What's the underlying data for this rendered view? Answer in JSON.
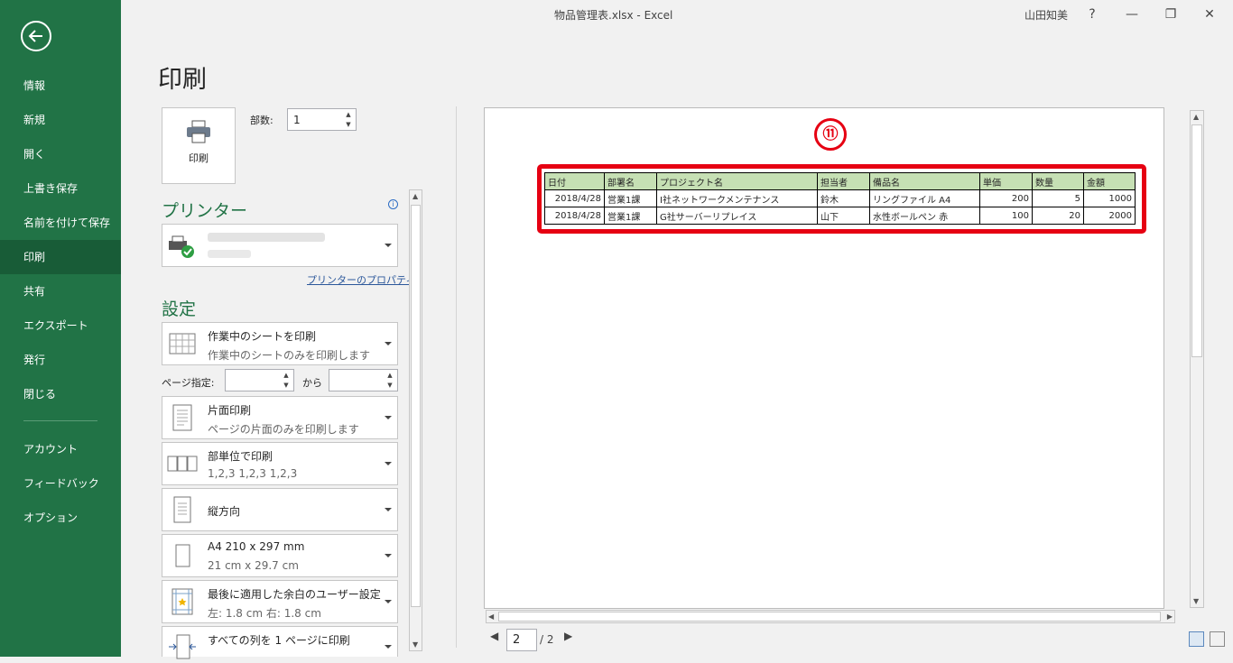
{
  "window": {
    "title": "物品管理表.xlsx  -  Excel",
    "user": "山田知美",
    "help": "?",
    "minimize": "—",
    "restore": "❐",
    "close": "✕"
  },
  "sidebar": {
    "items": [
      {
        "label": "情報"
      },
      {
        "label": "新規"
      },
      {
        "label": "開く"
      },
      {
        "label": "上書き保存"
      },
      {
        "label": "名前を付けて保存"
      },
      {
        "label": "印刷"
      },
      {
        "label": "共有"
      },
      {
        "label": "エクスポート"
      },
      {
        "label": "発行"
      },
      {
        "label": "閉じる"
      }
    ],
    "bottom_items": [
      {
        "label": "アカウント"
      },
      {
        "label": "フィードバック"
      },
      {
        "label": "オプション"
      }
    ]
  },
  "print": {
    "title": "印刷",
    "button_label": "印刷",
    "copies_label": "部数:",
    "copies_value": "1",
    "printer_heading": "プリンター",
    "printer_properties": "プリンターのプロパティ",
    "settings_heading": "設定",
    "pages_label": "ページ指定:",
    "pages_to": "から",
    "settings": [
      {
        "t1": "作業中のシートを印刷",
        "t2": "作業中のシートのみを印刷します"
      },
      {
        "t1": "片面印刷",
        "t2": "ページの片面のみを印刷します"
      },
      {
        "t1": "部単位で印刷",
        "t2": "1,2,3    1,2,3    1,2,3"
      },
      {
        "t1": "縦方向",
        "t2": ""
      },
      {
        "t1": "A4 210 x 297 mm",
        "t2": "21 cm x 29.7 cm"
      },
      {
        "t1": "最後に適用した余白のユーザー設定",
        "t2": "左:  1.8 cm    右:  1.8 cm"
      },
      {
        "t1": "すべての列を 1 ページに印刷",
        "t2": ""
      }
    ]
  },
  "preview": {
    "badge": "⑪",
    "table": {
      "headers": [
        "日付",
        "部署名",
        "プロジェクト名",
        "担当者",
        "備品名",
        "単価",
        "数量",
        "金額"
      ],
      "rows": [
        [
          "2018/4/28",
          "営業1課",
          "I社ネットワークメンテナンス",
          "鈴木",
          "リングファイル A4",
          "200",
          "5",
          "1000"
        ],
        [
          "2018/4/28",
          "営業1課",
          "G社サーバーリプレイス",
          "山下",
          "水性ボールペン  赤",
          "100",
          "20",
          "2000"
        ]
      ]
    },
    "page_current": "2",
    "page_total": "/ 2"
  }
}
